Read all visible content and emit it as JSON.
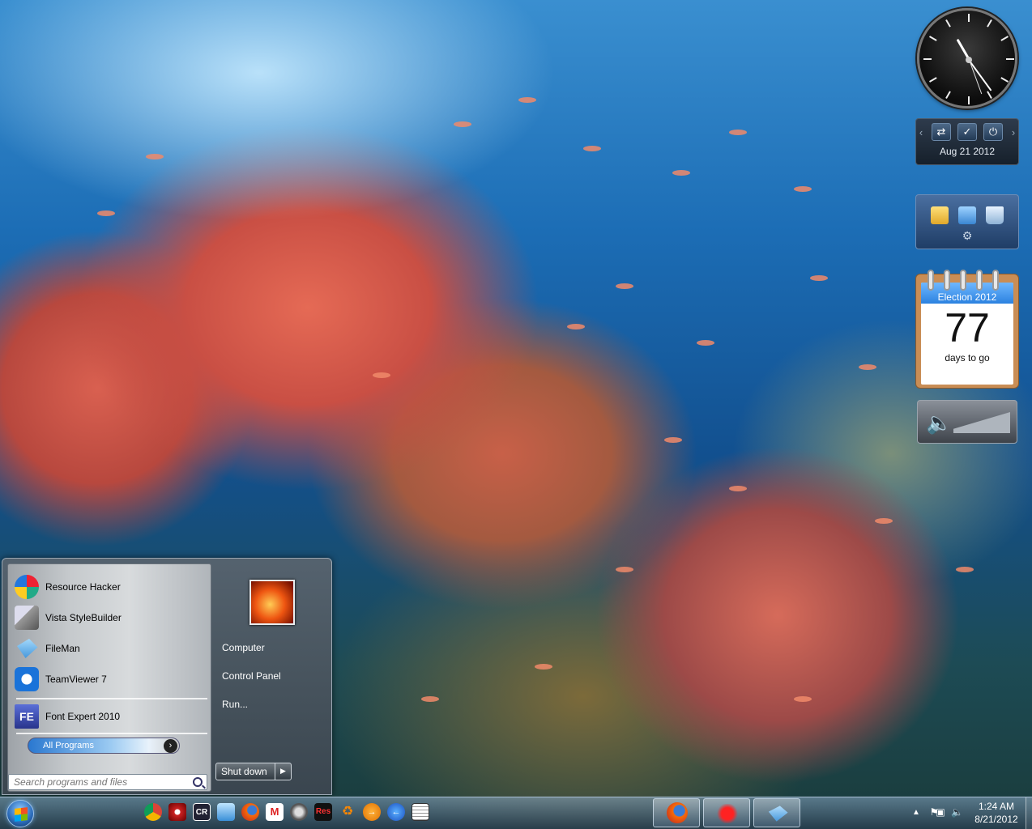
{
  "gadgets": {
    "control_date": "Aug 21 2012",
    "countdown": {
      "title": "Election 2012",
      "number": "77",
      "caption": "days to go"
    }
  },
  "start_menu": {
    "pinned": [
      {
        "label": "Resource Hacker",
        "icon": "resource-hacker-icon"
      },
      {
        "label": "Vista StyleBuilder",
        "icon": "vista-stylebuilder-icon"
      },
      {
        "label": "FileMan",
        "icon": "fileman-icon"
      },
      {
        "label": "TeamViewer 7",
        "icon": "teamviewer-icon"
      }
    ],
    "recent": [
      {
        "label": "Font Expert 2010",
        "icon": "font-expert-icon",
        "badge": "FE"
      }
    ],
    "all_programs": "All Programs",
    "search_placeholder": "Search programs and files",
    "right": [
      "Computer",
      "Control Panel",
      "Run..."
    ],
    "shutdown": "Shut down"
  },
  "taskbar": {
    "quick_launch": [
      {
        "name": "chrome-icon",
        "text": ""
      },
      {
        "name": "app-icon",
        "text": ""
      },
      {
        "name": "cr-icon",
        "text": "CR"
      },
      {
        "name": "fileman-icon",
        "text": ""
      },
      {
        "name": "firefox-icon",
        "text": ""
      },
      {
        "name": "gmail-icon",
        "text": "M"
      },
      {
        "name": "disk-icon",
        "text": ""
      },
      {
        "name": "reshacker-icon",
        "text": "Res"
      },
      {
        "name": "recycle-icon",
        "text": ""
      },
      {
        "name": "forward-icon",
        "text": ""
      },
      {
        "name": "back-icon",
        "text": ""
      },
      {
        "name": "notepad-icon",
        "text": ""
      }
    ],
    "time": "1:24 AM",
    "date": "8/21/2012"
  }
}
